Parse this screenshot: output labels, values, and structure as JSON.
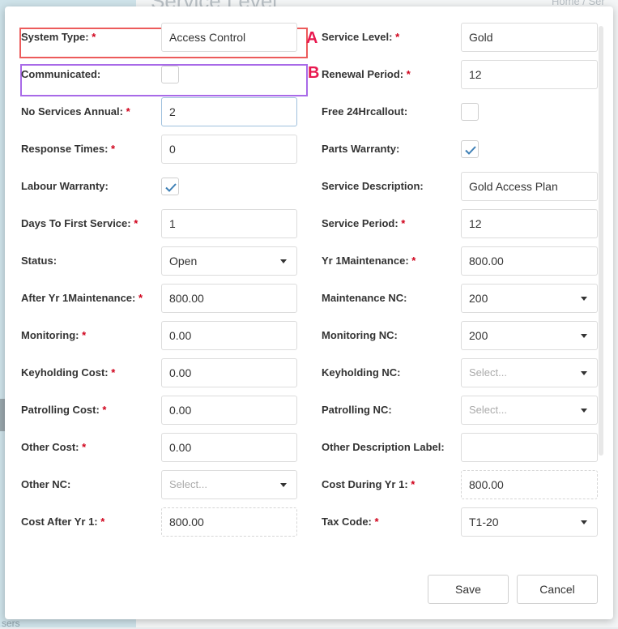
{
  "background": {
    "title": "Service Level",
    "breadcrumb": "Home / Ser",
    "bottom_text": "sers"
  },
  "annotations": {
    "a": "A",
    "b": "B"
  },
  "left": [
    {
      "id": "system-type",
      "label": "System Type:",
      "required": true,
      "kind": "input",
      "value": "Access Control"
    },
    {
      "id": "communicated",
      "label": "Communicated:",
      "required": false,
      "kind": "checkbox",
      "checked": false
    },
    {
      "id": "no-services-annual",
      "label": "No Services Annual:",
      "required": true,
      "kind": "input",
      "value": "2",
      "focused": true
    },
    {
      "id": "response-times",
      "label": "Response Times:",
      "required": true,
      "kind": "input",
      "value": "0"
    },
    {
      "id": "labour-warranty",
      "label": "Labour Warranty:",
      "required": false,
      "kind": "checkbox",
      "checked": true
    },
    {
      "id": "days-to-first-service",
      "label": "Days To First Service:",
      "required": true,
      "kind": "input",
      "value": "1"
    },
    {
      "id": "status",
      "label": "Status:",
      "required": false,
      "kind": "select",
      "value": "Open"
    },
    {
      "id": "after-yr1-maintenance",
      "label": "After Yr 1Maintenance:",
      "required": true,
      "kind": "input",
      "value": "800.00"
    },
    {
      "id": "monitoring",
      "label": "Monitoring:",
      "required": true,
      "kind": "input",
      "value": "0.00"
    },
    {
      "id": "keyholding-cost",
      "label": "Keyholding Cost:",
      "required": true,
      "kind": "input",
      "value": "0.00"
    },
    {
      "id": "patrolling-cost",
      "label": "Patrolling Cost:",
      "required": true,
      "kind": "input",
      "value": "0.00"
    },
    {
      "id": "other-cost",
      "label": "Other Cost:",
      "required": true,
      "kind": "input",
      "value": "0.00"
    },
    {
      "id": "other-nc",
      "label": "Other NC:",
      "required": false,
      "kind": "select",
      "value": "",
      "placeholder": "Select..."
    },
    {
      "id": "cost-after-yr1",
      "label": "Cost After Yr 1:",
      "required": true,
      "kind": "readonly",
      "value": "800.00"
    }
  ],
  "right": [
    {
      "id": "service-level",
      "label": "Service Level:",
      "required": true,
      "kind": "input",
      "value": "Gold"
    },
    {
      "id": "renewal-period",
      "label": "Renewal Period:",
      "required": true,
      "kind": "input",
      "value": "12"
    },
    {
      "id": "free-24hr-callout",
      "label": "Free 24Hrcallout:",
      "required": false,
      "kind": "checkbox",
      "checked": false
    },
    {
      "id": "parts-warranty",
      "label": "Parts Warranty:",
      "required": false,
      "kind": "checkbox",
      "checked": true
    },
    {
      "id": "service-description",
      "label": "Service Description:",
      "required": false,
      "kind": "input",
      "value": "Gold Access Plan"
    },
    {
      "id": "service-period",
      "label": "Service Period:",
      "required": true,
      "kind": "input",
      "value": "12"
    },
    {
      "id": "yr1-maintenance",
      "label": "Yr 1Maintenance:",
      "required": true,
      "kind": "input",
      "value": "800.00"
    },
    {
      "id": "maintenance-nc",
      "label": "Maintenance NC:",
      "required": false,
      "kind": "select",
      "value": "200"
    },
    {
      "id": "monitoring-nc",
      "label": "Monitoring NC:",
      "required": false,
      "kind": "select",
      "value": "200"
    },
    {
      "id": "keyholding-nc",
      "label": "Keyholding NC:",
      "required": false,
      "kind": "select",
      "value": "",
      "placeholder": "Select..."
    },
    {
      "id": "patrolling-nc",
      "label": "Patrolling NC:",
      "required": false,
      "kind": "select",
      "value": "",
      "placeholder": "Select..."
    },
    {
      "id": "other-description-label",
      "label": "Other Description Label:",
      "required": false,
      "kind": "input",
      "value": ""
    },
    {
      "id": "cost-during-yr1",
      "label": "Cost During Yr 1:",
      "required": true,
      "kind": "readonly",
      "value": "800.00"
    },
    {
      "id": "tax-code",
      "label": "Tax Code:",
      "required": true,
      "kind": "select",
      "value": "T1-20"
    }
  ],
  "buttons": {
    "save": "Save",
    "cancel": "Cancel"
  },
  "colors": {
    "required": "#d0021b",
    "annotation_a": "#ec5b5b",
    "annotation_b": "#a86ae8",
    "checkmark": "#3d7fb5"
  }
}
